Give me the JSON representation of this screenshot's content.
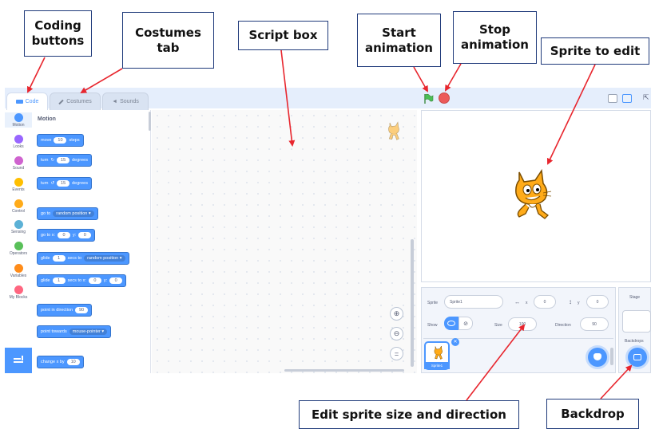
{
  "annotations": {
    "coding_buttons": [
      "Coding",
      "buttons"
    ],
    "costumes_tab": [
      "Costumes",
      "tab"
    ],
    "script_box": "Script box",
    "start_animation": [
      "Start",
      "animation"
    ],
    "stop_animation": [
      "Stop",
      "animation"
    ],
    "sprite_to_edit": "Sprite to edit",
    "edit_sprite": "Edit sprite size and direction",
    "backdrop": "Backdrop"
  },
  "tabs": [
    {
      "label": "Code",
      "icon": "code-icon"
    },
    {
      "label": "Costumes",
      "icon": "brush-icon"
    },
    {
      "label": "Sounds",
      "icon": "speaker-icon"
    }
  ],
  "categories": [
    {
      "label": "Motion",
      "color": "#4c97ff"
    },
    {
      "label": "Looks",
      "color": "#9966ff"
    },
    {
      "label": "Sound",
      "color": "#cf63cf"
    },
    {
      "label": "Events",
      "color": "#ffbf00"
    },
    {
      "label": "Control",
      "color": "#ffab19"
    },
    {
      "label": "Sensing",
      "color": "#5cb1d6"
    },
    {
      "label": "Operators",
      "color": "#59c059"
    },
    {
      "label": "Variables",
      "color": "#ff8c1a"
    },
    {
      "label": "My Blocks",
      "color": "#ff6680"
    }
  ],
  "palette": {
    "heading": "Motion",
    "move": {
      "pre": "move",
      "val": "10",
      "post": "steps"
    },
    "turn_right": {
      "pre": "turn",
      "val": "15",
      "post": "degrees"
    },
    "turn_left": {
      "pre": "turn",
      "val": "15",
      "post": "degrees"
    },
    "goto": {
      "pre": "go to",
      "dd": "random position"
    },
    "goto_xy": {
      "pre": "go to x:",
      "x": "0",
      "ylbl": "y:",
      "y": "0"
    },
    "glide_to": {
      "val": "1",
      "pre": "glide",
      "mid": "secs to",
      "dd": "random position"
    },
    "glide_xy": {
      "pre": "glide",
      "val": "1",
      "mid": "secs to x:",
      "x": "0",
      "ylbl": "y:",
      "y": "0"
    },
    "point_dir": {
      "pre": "point in direction",
      "val": "90"
    },
    "point_towards": {
      "pre": "point towards",
      "dd": "mouse-pointer"
    },
    "change_x": {
      "pre": "change x by",
      "val": "10"
    }
  },
  "sprite_info": {
    "sprite_label": "Sprite",
    "sprite_name": "Sprite1",
    "x_label": "x",
    "x_value": "0",
    "y_label": "y",
    "y_value": "0",
    "show_label": "Show",
    "size_label": "Size",
    "size_value": "100",
    "direction_label": "Direction",
    "direction_value": "90",
    "thumb_label": "Sprite1"
  },
  "stage_pane": {
    "stage_label": "Stage",
    "backdrops_label": "Backdrops"
  },
  "colors": {
    "accent": "#4c97ff",
    "annotation_border": "#1f3a7a",
    "arrow": "#e8262e",
    "flag": "#4cbf56",
    "stop": "#ec5959"
  }
}
